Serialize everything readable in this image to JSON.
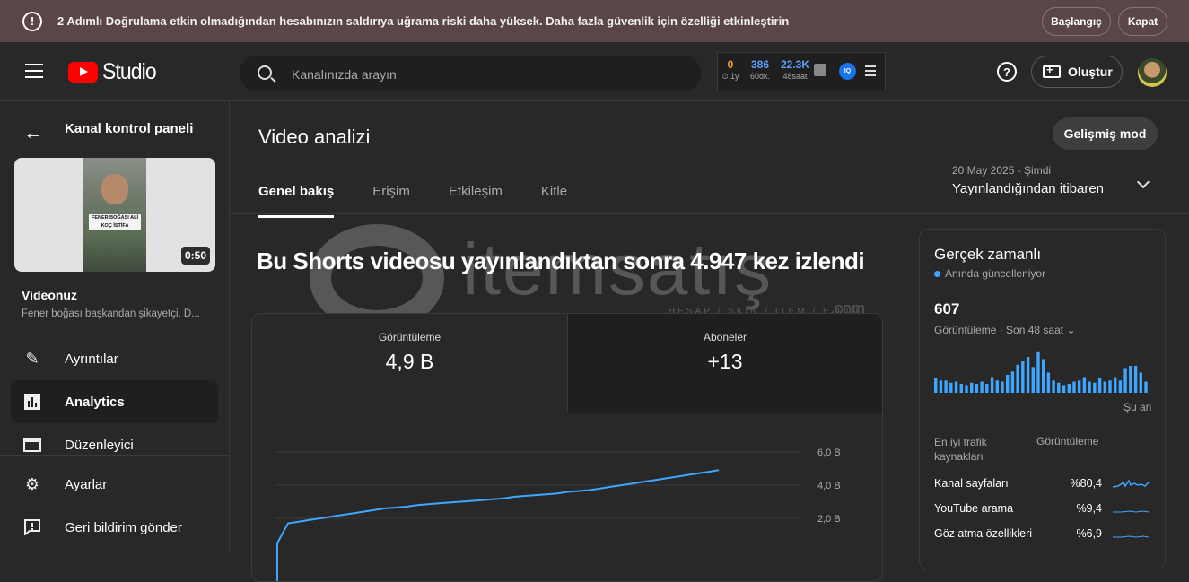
{
  "banner": {
    "message": "2 Adımlı Doğrulama etkin olmadığından hesabınızın saldırıya uğrama riski daha yüksek. Daha fazla güvenlik için özelliği etkinleştirin",
    "start_label": "Başlangıç",
    "close_label": "Kapat",
    "warning_icon_glyph": "!"
  },
  "header": {
    "logo_text": "Studio",
    "search_placeholder": "Kanalınızda arayın",
    "extension": {
      "a_value": "0",
      "a_sub": "⏱ 1y",
      "b_value": "386",
      "b_sub": "60dk.",
      "c_value": "22.3K",
      "c_sub": "48saat",
      "badge": "IQ"
    },
    "help_glyph": "?",
    "create_label": "Oluştur"
  },
  "sidebar": {
    "title": "Kanal kontrol paneli",
    "thumbnail_caption": "FENER BOĞASI ALİ KOÇ İSTİFA",
    "duration": "0:50",
    "video_label": "Videonuz",
    "video_desc": "Fener boğası başkandan şikayetçi. D...",
    "items": [
      {
        "label": "Ayrıntılar",
        "icon": "pencil-icon"
      },
      {
        "label": "Analytics",
        "icon": "analytics-icon"
      },
      {
        "label": "Düzenleyici",
        "icon": "editor-icon"
      }
    ],
    "bottom_items": [
      {
        "label": "Ayarlar",
        "icon": "gear-icon"
      },
      {
        "label": "Geri bildirim gönder",
        "icon": "feedback-icon"
      }
    ]
  },
  "main": {
    "title": "Video analizi",
    "advanced_mode_label": "Gelişmiş mod",
    "tabs": [
      "Genel bakış",
      "Erişim",
      "Etkileşim",
      "Kitle"
    ],
    "date_range": "20 May 2025 - Şimdi",
    "date_label": "Yayınlandığından itibaren",
    "headline": "Bu Shorts videosu yayınlandıktan sonra 4.947 kez izlendi",
    "stats": [
      {
        "label": "Görüntüleme",
        "value": "4,9 B"
      },
      {
        "label": "Aboneler",
        "value": "+13"
      }
    ],
    "chart": {
      "y_ticks": [
        "6,0 B",
        "4,0 B",
        "2,0 B"
      ],
      "views_thousands": [
        0.5,
        1.7,
        1.8,
        1.9,
        2.0,
        2.1,
        2.2,
        2.3,
        2.4,
        2.5,
        2.6,
        2.65,
        2.7,
        2.8,
        2.85,
        2.9,
        2.95,
        3.0,
        3.05,
        3.1,
        3.15,
        3.2,
        3.3,
        3.35,
        3.4,
        3.45,
        3.5,
        3.6,
        3.65,
        3.7,
        3.8,
        3.9,
        4.0,
        4.1,
        4.2,
        4.3,
        4.4,
        4.5,
        4.6,
        4.7,
        4.8,
        4.9
      ]
    },
    "watermark": {
      "text": "itemsatış",
      "sub": "HESAP / SKIN / ITEM / E-PIN",
      "com": ".com"
    }
  },
  "realtime": {
    "title": "Gerçek zamanlı",
    "live_label": "Anında güncelleniyor",
    "count": "607",
    "count_label": "Görüntüleme · Son 48 saat",
    "now_label": "Şu an",
    "bars": [
      13,
      11,
      11,
      9,
      10,
      8,
      7,
      9,
      8,
      10,
      8,
      14,
      11,
      10,
      16,
      19,
      25,
      28,
      32,
      23,
      37,
      30,
      18,
      11,
      9,
      7,
      8,
      10,
      11,
      14,
      10,
      9,
      13,
      10,
      11,
      14,
      11,
      22,
      24,
      24,
      18,
      10
    ],
    "traffic_header": "En iyi trafik kaynakları",
    "views_header": "Görüntüleme",
    "sources": [
      {
        "name": "Kanal sayfaları",
        "pct": "%80,4"
      },
      {
        "name": "YouTube arama",
        "pct": "%9,4"
      },
      {
        "name": "Göz atma özellikleri",
        "pct": "%6,9"
      }
    ],
    "accent": "#3ea6ff"
  }
}
